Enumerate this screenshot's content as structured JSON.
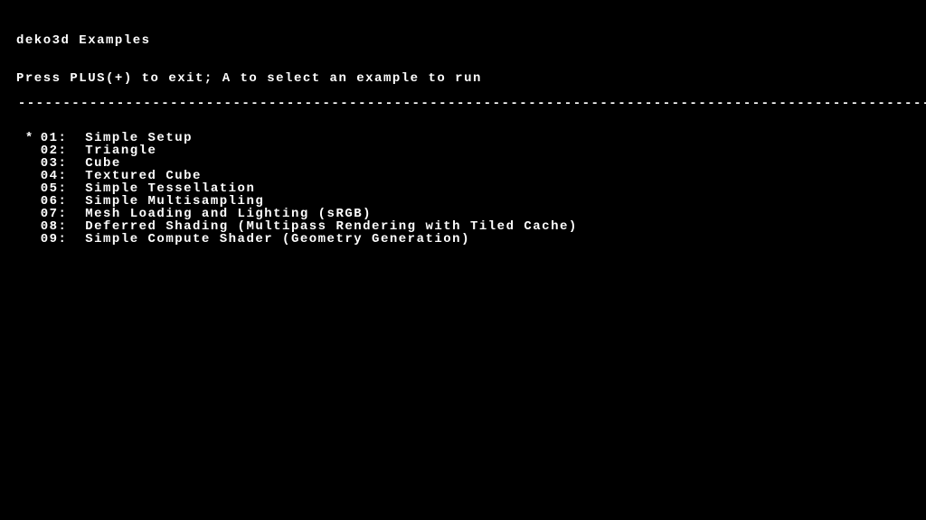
{
  "header": {
    "title": "deko3d Examples",
    "instructions": "Press PLUS(+) to exit; A to select an example to run"
  },
  "divider": "------------------------------------------------------------------------------------------------------------",
  "selected_index": 0,
  "items": [
    {
      "num": "01",
      "label": "Simple Setup"
    },
    {
      "num": "02",
      "label": "Triangle"
    },
    {
      "num": "03",
      "label": "Cube"
    },
    {
      "num": "04",
      "label": "Textured Cube"
    },
    {
      "num": "05",
      "label": "Simple Tessellation"
    },
    {
      "num": "06",
      "label": "Simple Multisampling"
    },
    {
      "num": "07",
      "label": "Mesh Loading and Lighting (sRGB)"
    },
    {
      "num": "08",
      "label": "Deferred Shading (Multipass Rendering with Tiled Cache)"
    },
    {
      "num": "09",
      "label": "Simple Compute Shader (Geometry Generation)"
    }
  ]
}
